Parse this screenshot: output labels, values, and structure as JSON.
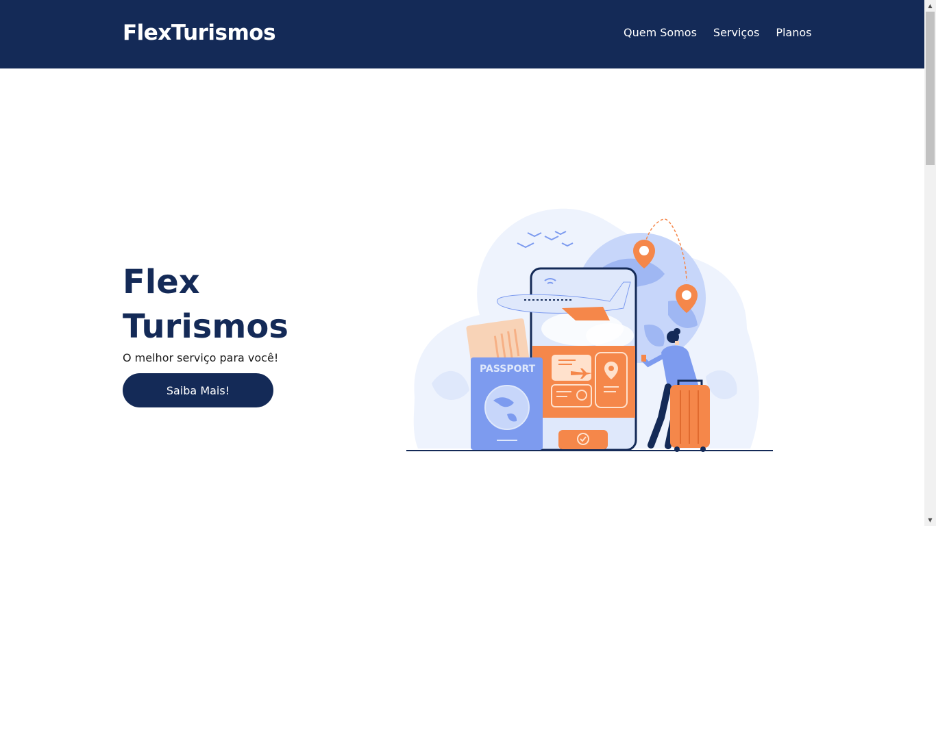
{
  "nav": {
    "brand": "FlexTurismos",
    "links": [
      "Quem Somos",
      "Serviços",
      "Planos"
    ]
  },
  "hero": {
    "title_line1": "Flex",
    "title_line2": "Turismos",
    "subtitle": "O melhor serviço para você!",
    "button_label": "Saiba Mais!"
  },
  "illustration": {
    "passport_text": "PASSPORT"
  },
  "colors": {
    "navy": "#142a57",
    "orange": "#f5874a",
    "light_blue": "#dfe8fb",
    "mid_blue": "#7d9bef"
  },
  "icons": [
    "chevron-up-icon",
    "chevron-down-icon"
  ]
}
